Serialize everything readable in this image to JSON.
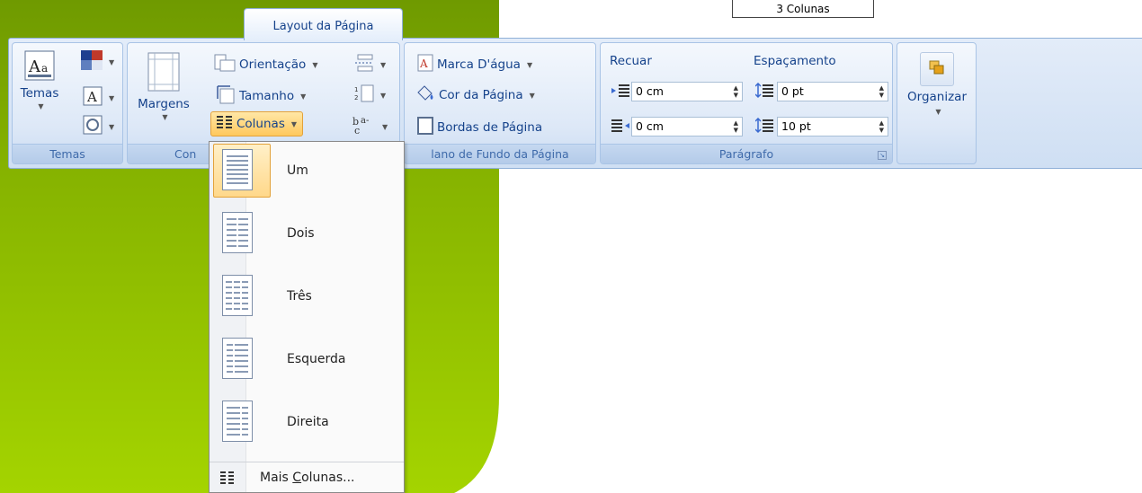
{
  "caption": "3 Colunas",
  "active_tab": "Layout da Página",
  "groups": {
    "temas": {
      "label": "Temas",
      "themes_button": "Temas"
    },
    "configurar": {
      "label_visible": "Con",
      "margins_button": "Margens",
      "orientation_button": "Orientação",
      "size_button": "Tamanho",
      "columns_button": "Colunas"
    },
    "fundo": {
      "label_visible": "lano de Fundo da Página",
      "watermark_button": "Marca D'água",
      "page_color_button": "Cor da Página",
      "page_borders_button": "Bordas de Página"
    },
    "paragrafo": {
      "label": "Parágrafo",
      "indent_header": "Recuar",
      "spacing_header": "Espaçamento",
      "indent_left_value": "0 cm",
      "indent_right_value": "0 cm",
      "spacing_before_value": "0 pt",
      "spacing_after_value": "10 pt"
    },
    "organizar": {
      "button": "Organizar"
    }
  },
  "columns_menu": {
    "items": [
      {
        "label": "Um",
        "selected": true
      },
      {
        "label": "Dois",
        "selected": false
      },
      {
        "label": "Três",
        "selected": false
      },
      {
        "label": "Esquerda",
        "selected": false
      },
      {
        "label": "Direita",
        "selected": false
      }
    ],
    "more_prefix": "Mais ",
    "more_underlined": "C",
    "more_suffix": "olunas..."
  },
  "colors": {
    "green_light": "#9ccc00",
    "green_dark": "#6f9a00",
    "ribbon_text": "#15428b",
    "highlight": "#ffd88a"
  }
}
